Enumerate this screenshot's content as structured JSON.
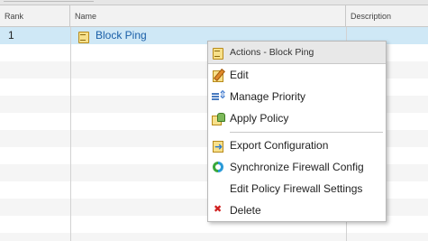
{
  "table": {
    "columns": {
      "rank": "Rank",
      "name": "Name",
      "description": "Description"
    },
    "rows": [
      {
        "rank": "1",
        "name": "Block Ping",
        "icon": "policy-icon",
        "selected": true
      }
    ]
  },
  "context_menu": {
    "title": "Actions - Block Ping",
    "items": [
      {
        "label": "Edit",
        "icon": "edit-icon"
      },
      {
        "label": "Manage Priority",
        "icon": "priority-icon"
      },
      {
        "label": "Apply Policy",
        "icon": "apply-policy-icon"
      },
      {
        "label": "Export Configuration",
        "icon": "export-icon"
      },
      {
        "label": "Synchronize Firewall Config",
        "icon": "sync-icon"
      },
      {
        "label": "Edit Policy Firewall Settings",
        "icon": ""
      },
      {
        "label": "Delete",
        "icon": "delete-icon"
      }
    ]
  },
  "colors": {
    "selected_row": "#cfe8f6",
    "link": "#1a5fa8",
    "delete": "#d02020"
  }
}
